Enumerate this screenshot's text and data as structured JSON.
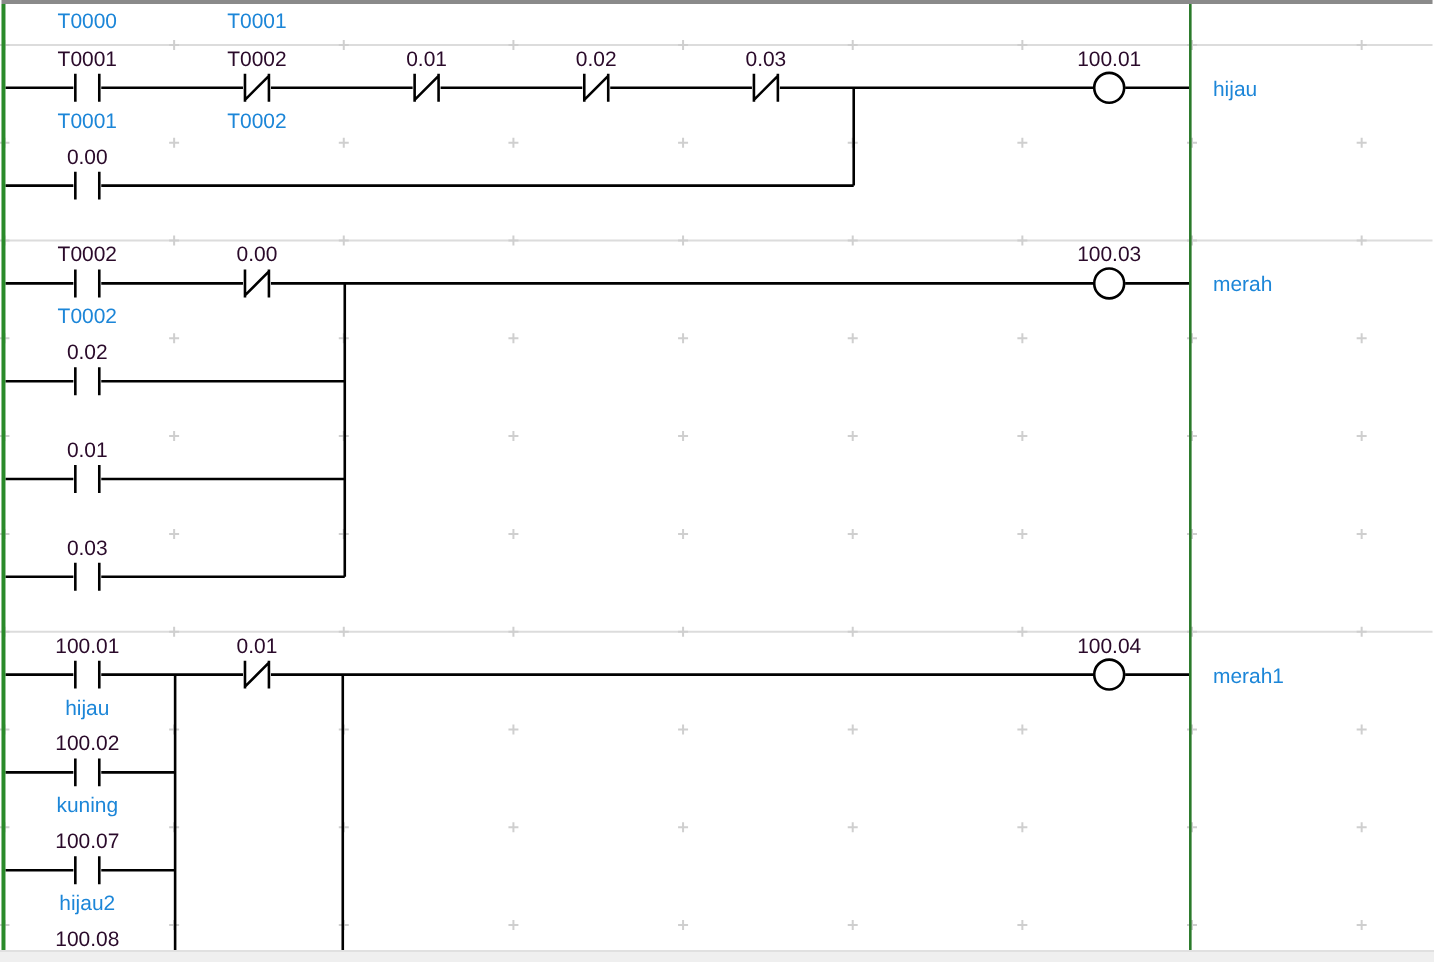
{
  "top_comments": [
    "T0000",
    "T0001"
  ],
  "rungs": [
    {
      "rows": [
        [
          {
            "kind": "no",
            "address": "T0001",
            "comment": "T0001"
          },
          {
            "kind": "nc",
            "address": "T0002",
            "comment": "T0002"
          },
          {
            "kind": "nc",
            "address": "0.01"
          },
          {
            "kind": "nc",
            "address": "0.02"
          },
          {
            "kind": "nc",
            "address": "0.03"
          }
        ],
        [
          {
            "kind": "no",
            "address": "0.00"
          }
        ]
      ],
      "coil": {
        "address": "100.01",
        "comment": "hijau"
      }
    },
    {
      "rows": [
        [
          {
            "kind": "no",
            "address": "T0002",
            "comment": "T0002"
          },
          {
            "kind": "nc",
            "address": "0.00"
          }
        ],
        [
          {
            "kind": "no",
            "address": "0.02"
          }
        ],
        [
          {
            "kind": "no",
            "address": "0.01"
          }
        ],
        [
          {
            "kind": "no",
            "address": "0.03"
          }
        ]
      ],
      "coil": {
        "address": "100.03",
        "comment": "merah"
      }
    },
    {
      "rows": [
        [
          {
            "kind": "no",
            "address": "100.01",
            "comment": "hijau"
          }
        ],
        [
          {
            "kind": "no",
            "address": "100.02",
            "comment": "kuning"
          }
        ],
        [
          {
            "kind": "no",
            "address": "100.07",
            "comment": "hijau2"
          }
        ],
        [
          {
            "address": "100.08"
          }
        ]
      ],
      "series": [
        {
          "kind": "nc",
          "address": "0.01"
        }
      ],
      "continues_below": true,
      "coil": {
        "address": "100.04",
        "comment": "merah1"
      }
    }
  ]
}
